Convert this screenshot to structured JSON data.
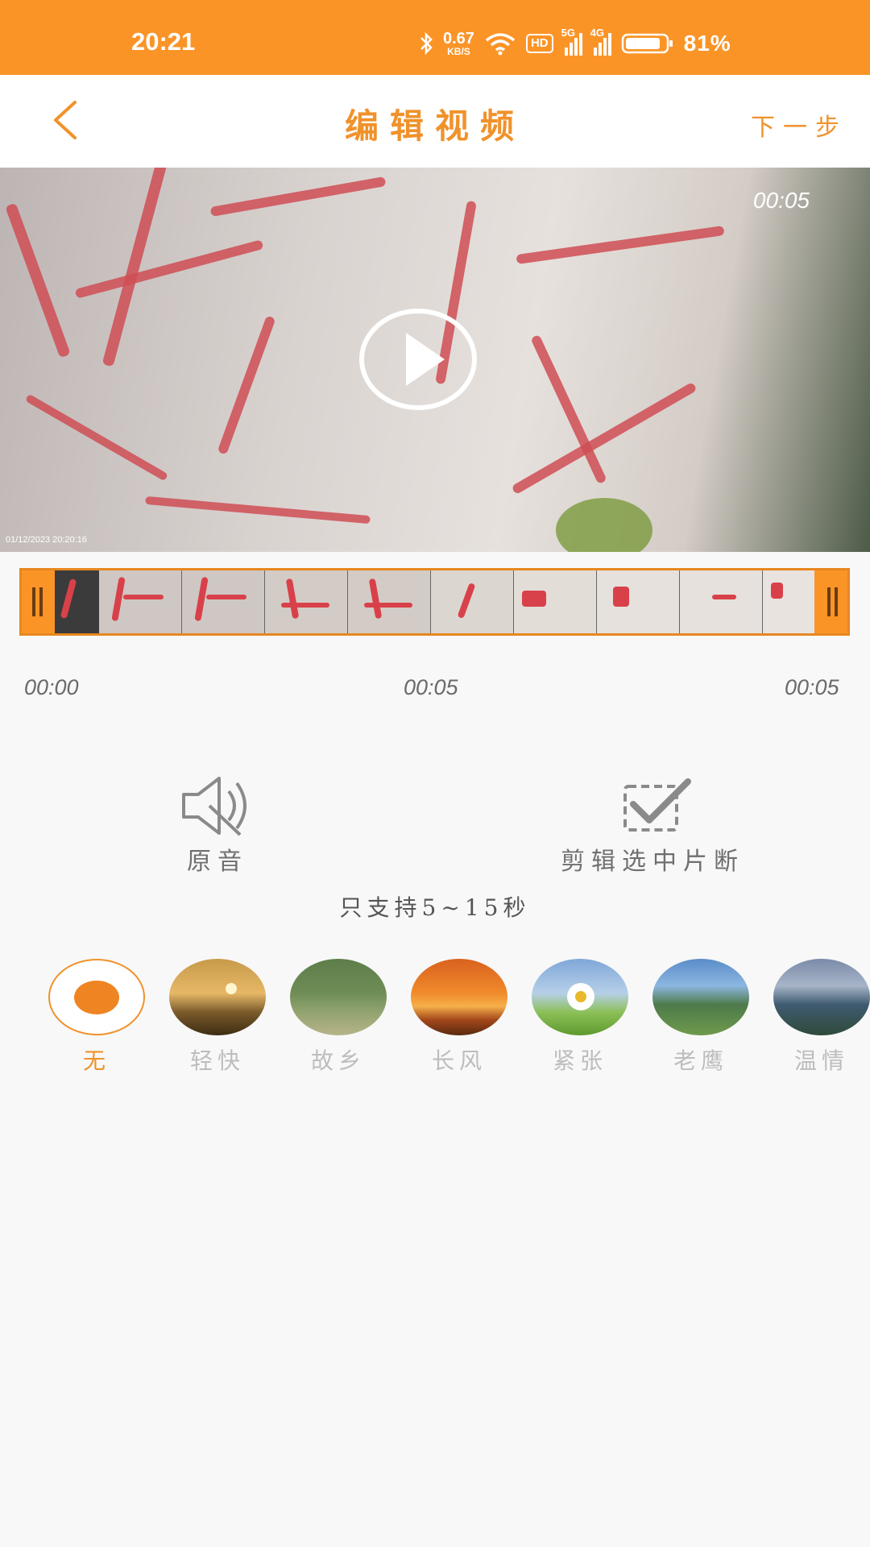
{
  "status_bar": {
    "time": "20:21",
    "net_speed_value": "0.67",
    "net_speed_unit": "KB/S",
    "hd_label": "HD",
    "sim1_label": "5G",
    "sim2_label": "4G",
    "battery": "81%",
    "icons": [
      "bluetooth-icon",
      "wifi-icon",
      "hd-icon",
      "signal-5g-icon",
      "signal-4g-icon",
      "battery-icon"
    ]
  },
  "header": {
    "title": "编辑视频",
    "next_label": "下一步"
  },
  "video": {
    "duration": "00:05",
    "timestamp": "01/12/2023 20:20:16"
  },
  "timeline": {
    "start": "00:00",
    "middle": "00:05",
    "end": "00:05"
  },
  "tools": {
    "original_audio": "原音",
    "trim_selected": "剪辑选中片断"
  },
  "hint": "只支持5~15秒",
  "music": {
    "items": [
      {
        "label": "无",
        "selected": true
      },
      {
        "label": "轻快",
        "selected": false
      },
      {
        "label": "故乡",
        "selected": false
      },
      {
        "label": "长风",
        "selected": false
      },
      {
        "label": "紧张",
        "selected": false
      },
      {
        "label": "老鹰",
        "selected": false
      },
      {
        "label": "温情",
        "selected": false
      }
    ]
  },
  "colors": {
    "accent": "#fb9427",
    "title_orange": "#f0922b"
  }
}
